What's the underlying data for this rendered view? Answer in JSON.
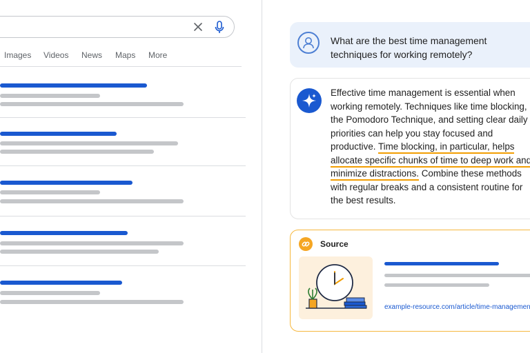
{
  "search": {
    "clear_icon": "close-icon",
    "mic_icon": "mic-icon"
  },
  "tabs": [
    "Images",
    "Videos",
    "News",
    "Maps",
    "More"
  ],
  "chat": {
    "question": "What are the best time management techniques for working remotely?",
    "answer_part1": "Effective time management is essential when working remotely. Techniques like time blocking, the Pomodoro Technique, and setting clear daily priorities can help you stay focused and productive. ",
    "answer_highlight": "Time blocking, in particular, helps allocate specific chunks of time to deep work and minimize distractions.",
    "answer_part2": " Combine these methods with regular breaks and a consistent routine for the best results."
  },
  "source": {
    "label": "Source",
    "url": "example-resource.com/article/time-management"
  },
  "colors": {
    "accent_blue": "#1a59d0",
    "highlight_orange": "#f29d00",
    "source_border": "#f6b73c"
  }
}
